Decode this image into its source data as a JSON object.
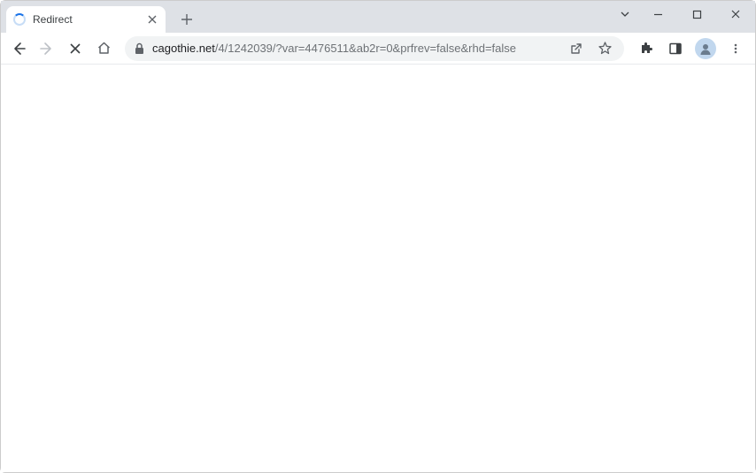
{
  "tab": {
    "title": "Redirect"
  },
  "address": {
    "domain": "cagothie.net",
    "path": "/4/1242039/?var=4476511&ab2r=0&prfrev=false&rhd=false"
  }
}
